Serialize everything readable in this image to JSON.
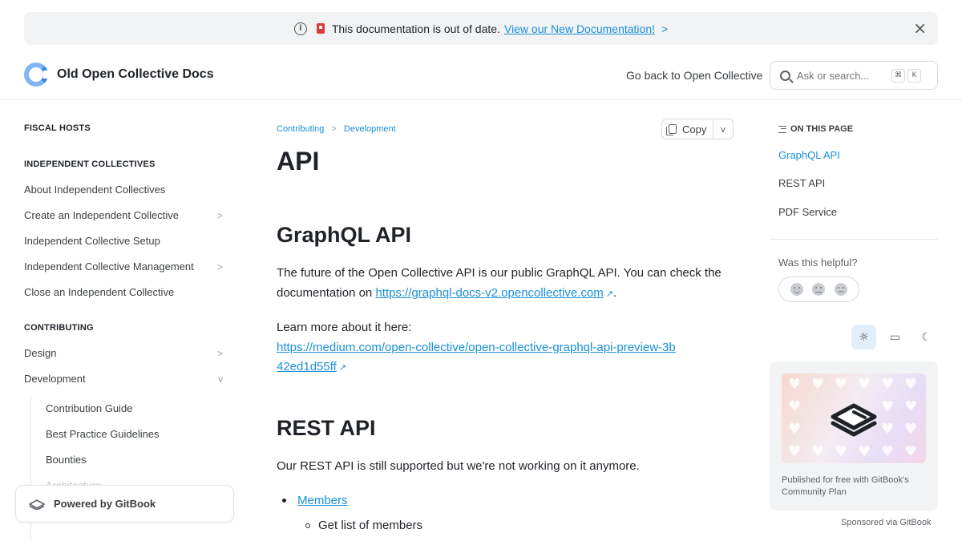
{
  "banner": {
    "message": "This documentation is out of date.",
    "link_label": "View our New Documentation!"
  },
  "header": {
    "site_title": "Old Open Collective Docs",
    "back_link": "Go back to Open Collective",
    "search": {
      "placeholder": "Ask or search...",
      "shortcut_keys": [
        "⌘",
        "K"
      ]
    }
  },
  "sidebar": {
    "sections": [
      {
        "title": "FISCAL HOSTS"
      },
      {
        "title": "INDEPENDENT COLLECTIVES"
      },
      {
        "title": "CONTRIBUTING"
      }
    ],
    "items": [
      {
        "label": "About Independent Collectives"
      },
      {
        "label": "Create an Independent Collective"
      },
      {
        "label": "Independent Collective Setup"
      },
      {
        "label": "Independent Collective Management"
      },
      {
        "label": "Close an Independent Collective"
      },
      {
        "label": "Design"
      },
      {
        "label": "Development"
      }
    ],
    "sub_items": [
      {
        "label": "Contribution Guide"
      },
      {
        "label": "Best Practice Guidelines"
      },
      {
        "label": "Bounties"
      },
      {
        "label": "Architecture"
      }
    ],
    "powered_by": "Powered by GitBook"
  },
  "main": {
    "breadcrumb": [
      "Contributing",
      "Development"
    ],
    "copy_label": "Copy",
    "title": "API",
    "graphql": {
      "heading": "GraphQL API",
      "para1_text": "The future of the Open Collective API is our public GraphQL API. You can check the documentation on",
      "para1_link": "https://graphql-docs-v2.opencollective.com",
      "para2_text": "Learn more about it here:",
      "para2_link": "https://medium.com/open-collective/open-collective-graphql-api-preview-3b42ed1d55ff"
    },
    "rest": {
      "heading": "REST API",
      "para": "Our REST API is still supported but we're not working on it anymore.",
      "list_item": "Members",
      "sub_item": "Get list of members"
    }
  },
  "toc": {
    "heading": "ON THIS PAGE",
    "items": [
      "GraphQL API",
      "REST API",
      "PDF Service"
    ],
    "helpful": "Was this helpful?"
  },
  "sponsor": {
    "text": "Published for free with GitBook's Community Plan",
    "sponsored_by": "Sponsored via GitBook"
  },
  "colors": {
    "accent": "#1a8fd8",
    "banner_bg": "#f2f3f4",
    "logo_light": "#7fb6f3",
    "logo_dark": "#3b82e8"
  }
}
